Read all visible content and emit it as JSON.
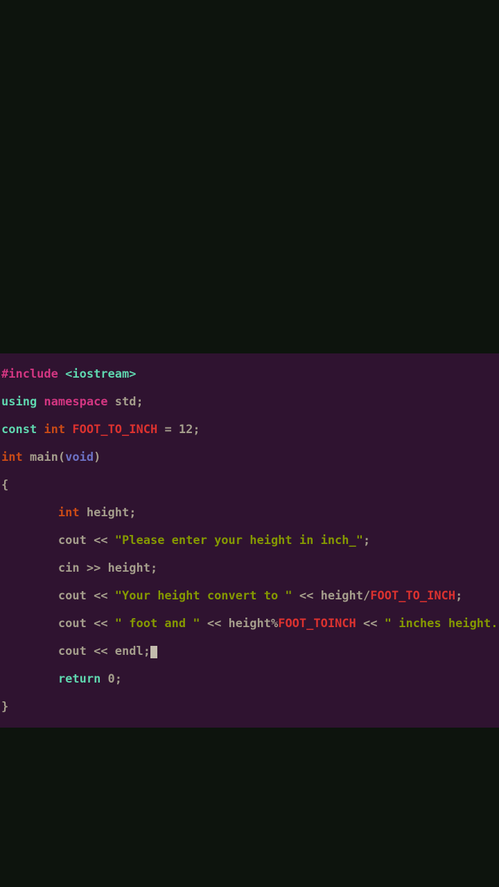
{
  "code": {
    "l0_pre": "#include",
    "l0_hdr": " <iostream>",
    "l1_using": "using",
    "l1_ns": " namespace",
    "l1_std": " std",
    "l1_semi": ";",
    "l2_const": "const",
    "l2_int": " int",
    "l2_sp": " ",
    "l2_name": "FOOT_TO_INCH",
    "l2_eq": " = 12;",
    "l3_int": "int",
    "l3_main": " main(",
    "l3_void": "void",
    "l3_close": ")",
    "l4_brace": "{",
    "l5_indent": "        ",
    "l5_int": "int",
    "l5_h": " height;",
    "l6_indent": "        ",
    "l6_cout": "cout << ",
    "l6_str": "\"Please enter your height in inch_\"",
    "l6_semi": ";",
    "l7_indent": "        ",
    "l7_cin": "cin >> height;",
    "l8_indent": "        ",
    "l8_cout": "cout << ",
    "l8_str": "\"Your height convert to \"",
    "l8_mid": " << height/",
    "l8_const": "FOOT_TO_INCH",
    "l8_semi": ";",
    "l9_indent": "        ",
    "l9_cout": "cout << ",
    "l9_str1": "\" foot and \"",
    "l9_mid": " << height%",
    "l9_const": "FOOT_TOINCH",
    "l9_out": " << ",
    "l9_str2": "\" inches height.\"",
    "l9_semi": ";",
    "l10_indent": "        ",
    "l10_cout": "cout << endl;",
    "l11_indent": "        ",
    "l11_ret": "return",
    "l11_zero": " 0;",
    "l12_brace": "}"
  }
}
